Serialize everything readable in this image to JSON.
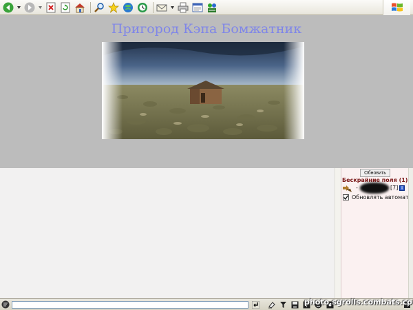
{
  "top": {
    "title": "Пригород Кэпа Бомжатник"
  },
  "side_panel": {
    "refresh_label": "Обновить",
    "location_title": "Бескрайние поля (1)",
    "user_prefix": "-",
    "user_level": "[7]",
    "info_label": "i",
    "auto_refresh_label": "Обновлять автомат.",
    "auto_refresh_checked": true
  },
  "bottom": {
    "chat_value": "",
    "watermark": "photo.sgrolls.combats.com"
  },
  "icons": {
    "toolbar": [
      "back-icon",
      "forward-icon",
      "stop-icon",
      "refresh-icon",
      "home-icon",
      "search-icon",
      "favorites-icon",
      "media-icon",
      "history-icon",
      "mail-icon",
      "print-icon",
      "edit-icon",
      "messenger-icon"
    ],
    "bottom_bar": [
      "enter-icon",
      "clear-icon",
      "filter-icon",
      "translit-icon",
      "save-icon",
      "smiles-icon",
      "settings-icon",
      "exit-icon"
    ]
  },
  "colors": {
    "title": "#7f86e8",
    "location_title": "#7a1818",
    "top_frame_bg": "#bcbcbc",
    "main_bg": "#f2f1f1",
    "side_bg": "#fbf1f1"
  }
}
